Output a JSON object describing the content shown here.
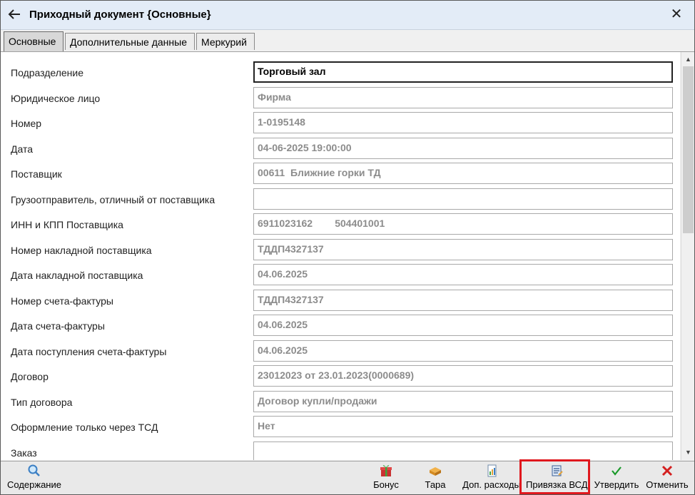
{
  "window": {
    "title": "Приходный документ {Основные}",
    "close_glyph": "✕"
  },
  "tabs": [
    {
      "label": "Основные",
      "active": true
    },
    {
      "label": "Дополнительные данные",
      "active": false
    },
    {
      "label": "Меркурий",
      "active": false
    }
  ],
  "form": {
    "rows": [
      {
        "label": "Подразделение",
        "value": "Торговый зал"
      },
      {
        "label": "Юридическое лицо",
        "value": "Фирма"
      },
      {
        "label": "Номер",
        "value": "1-0195148"
      },
      {
        "label": "Дата",
        "value": "04-06-2025 19:00:00"
      },
      {
        "label": "Поставщик",
        "value": "00611  Ближние горки ТД"
      },
      {
        "label": "Грузоотправитель, отличный от поставщика",
        "value": ""
      },
      {
        "label": "ИНН и КПП Поставщика",
        "value": "6911023162        504401001"
      },
      {
        "label": "Номер накладной поставщика",
        "value": "ТДДП4327137"
      },
      {
        "label": "Дата накладной поставщика",
        "value": "04.06.2025"
      },
      {
        "label": "Номер счета-фактуры",
        "value": "ТДДП4327137"
      },
      {
        "label": "Дата счета-фактуры",
        "value": "04.06.2025"
      },
      {
        "label": "Дата поступления счета-фактуры",
        "value": "04.06.2025"
      },
      {
        "label": "Договор",
        "value": "23012023 от 23.01.2023(0000689)"
      },
      {
        "label": "Тип договора",
        "value": "Договор купли/продажи"
      },
      {
        "label": "Оформление только через ТСД",
        "value": "Нет"
      },
      {
        "label": "Заказ",
        "value": ""
      }
    ]
  },
  "toolbar": {
    "contents_label": "Содержание",
    "bonus_label": "Бонус",
    "tara_label": "Тара",
    "extra_costs_label": "Доп. расходы",
    "vsd_link_label": "Привязка ВСД",
    "approve_label": "Утвердить",
    "cancel_label": "Отменить"
  },
  "colors": {
    "highlight": "#e0181e",
    "approve": "#1a9a2a",
    "cancel": "#d42020"
  }
}
